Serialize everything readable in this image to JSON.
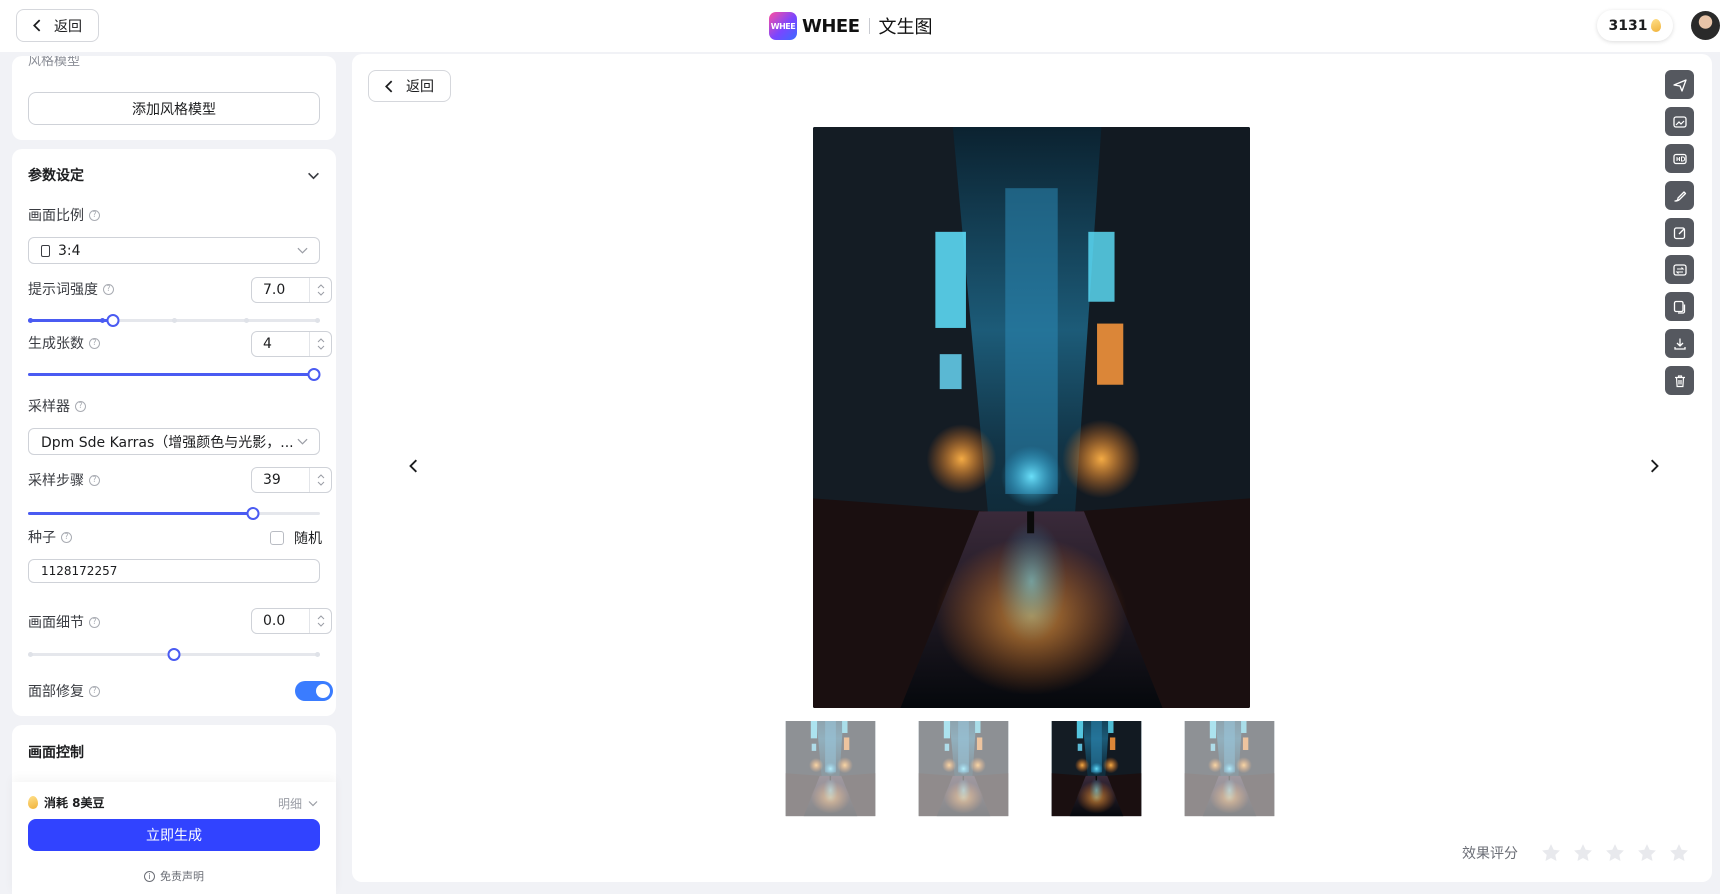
{
  "topbar": {
    "back_label": "返回",
    "brand_logo_text": "WHEE",
    "brand_name": "WHEE",
    "page_title": "文生图",
    "credits": "3131"
  },
  "style_panel": {
    "section_label": "风格模型",
    "add_style_label": "添加风格模型"
  },
  "params": {
    "title": "参数设定",
    "aspect_ratio": {
      "label": "画面比例",
      "value": "3:4"
    },
    "prompt_strength": {
      "label": "提示词强度",
      "value": "7.0",
      "fraction": 0.29
    },
    "image_count": {
      "label": "生成张数",
      "value": "4",
      "fraction": 1.0
    },
    "sampler": {
      "label": "采样器",
      "value": "Dpm Sde Karras（增强颜色与光影，..."
    },
    "sampling_steps": {
      "label": "采样步骤",
      "value": "39",
      "fraction": 0.77
    },
    "seed": {
      "label": "种子",
      "random_label": "随机",
      "random_checked": false,
      "value": "1128172257"
    },
    "detail": {
      "label": "画面细节",
      "value": "0.0",
      "fraction": 0.5
    },
    "face_restore": {
      "label": "面部修复",
      "enabled": true
    }
  },
  "control": {
    "title": "画面控制"
  },
  "footer": {
    "cost_label": "消耗 8美豆",
    "detail_label": "明细",
    "generate_label": "立即生成",
    "disclaimer_label": "免责声明"
  },
  "viewer": {
    "back_label": "返回",
    "rating_label": "效果评分",
    "rating_value": 0,
    "rating_max": 5,
    "thumbnail_count": 4,
    "selected_thumbnail": 3,
    "tools": [
      "send-icon",
      "image-edit-icon",
      "hd-icon",
      "brush-icon",
      "edit-icon",
      "swap-image-icon",
      "copy-icon",
      "download-icon",
      "trash-icon"
    ]
  },
  "colors": {
    "accent": "#3143ff",
    "slider": "#4a5bf2",
    "toggle": "#3a7cff",
    "tool_bg": "#55585f",
    "page_bg": "#f1f2f6"
  }
}
